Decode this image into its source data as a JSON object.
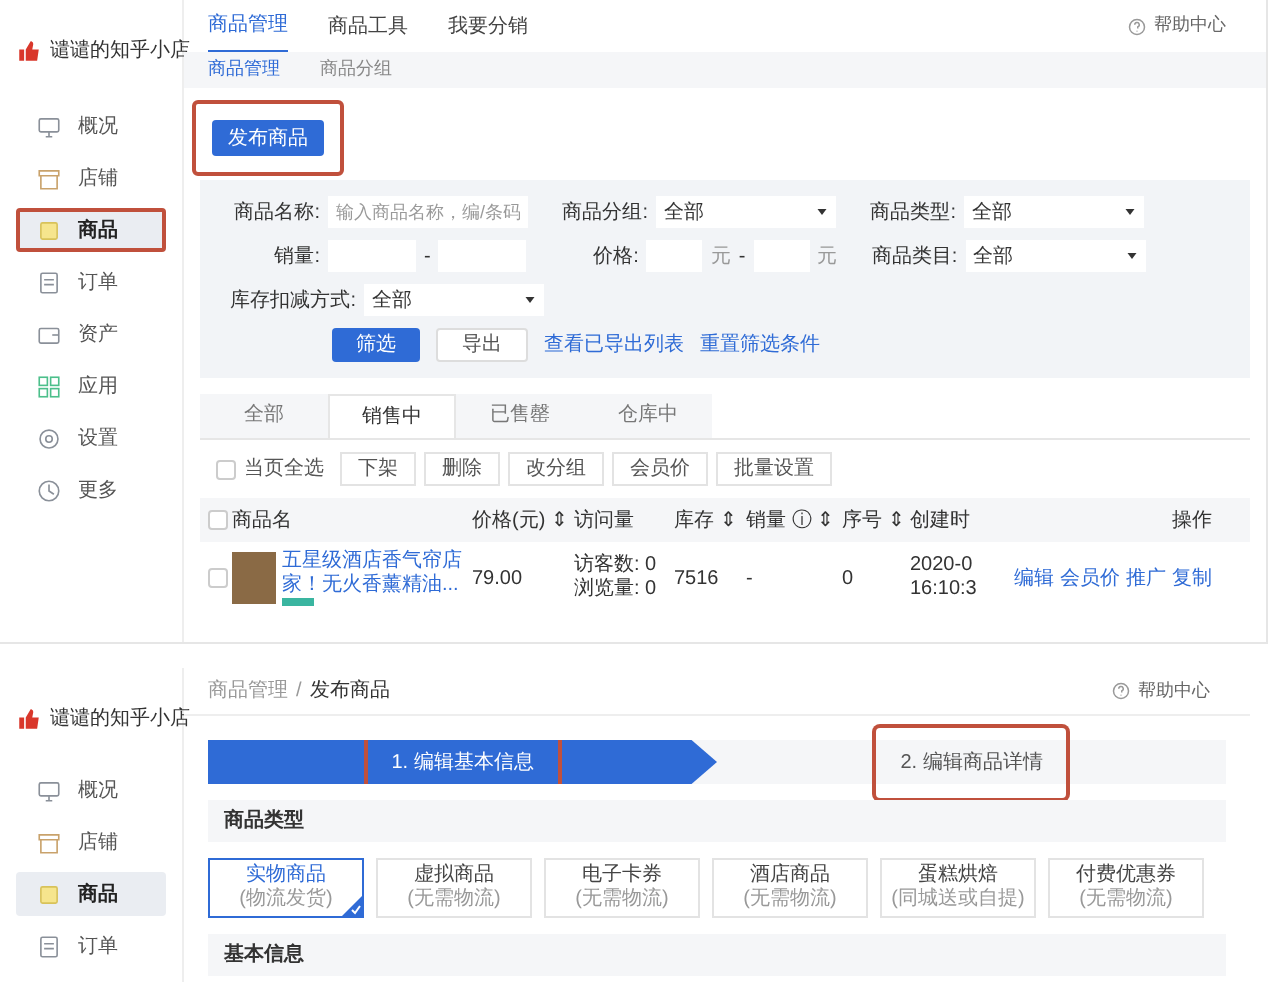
{
  "top_screen": {
    "shop": {
      "name": "谴谴的知乎小店"
    },
    "sidebar": {
      "items": [
        {
          "label": "概况",
          "selected": false,
          "highlighted": false
        },
        {
          "label": "店铺",
          "selected": false,
          "highlighted": false
        },
        {
          "label": "商品",
          "selected": true,
          "highlighted": true
        },
        {
          "label": "订单",
          "selected": false,
          "highlighted": false
        },
        {
          "label": "资产",
          "selected": false,
          "highlighted": false
        },
        {
          "label": "应用",
          "selected": false,
          "highlighted": false
        },
        {
          "label": "设置",
          "selected": false,
          "highlighted": false
        },
        {
          "label": "更多",
          "selected": false,
          "highlighted": false
        }
      ]
    },
    "top_tabs": [
      {
        "label": "商品管理",
        "selected": true
      },
      {
        "label": "商品工具",
        "selected": false
      },
      {
        "label": "我要分销",
        "selected": false
      }
    ],
    "help": "帮助中心",
    "sub_tabs": [
      {
        "label": "商品管理",
        "selected": true
      },
      {
        "label": "商品分组",
        "selected": false
      }
    ],
    "publish_button": {
      "label": "发布商品",
      "highlighted": true
    },
    "filters": {
      "name_label": "商品名称:",
      "name_placeholder": "输入商品名称，编/条码",
      "group_label": "商品分组:",
      "group_value": "全部",
      "type_label": "商品类型:",
      "type_value": "全部",
      "sales_label": "销量:",
      "sales_dash": "-",
      "price_label": "价格:",
      "price_unit_1": "元",
      "price_dash": "-",
      "price_unit_2": "元",
      "category_label": "商品类目:",
      "category_value": "全部",
      "stock_label": "库存扣减方式:",
      "stock_value": "全部",
      "filter_button": "筛选",
      "export_button": "导出",
      "exported_link": "查看已导出列表",
      "reset_link": "重置筛选条件"
    },
    "status_tabs": [
      {
        "label": "全部",
        "selected": false
      },
      {
        "label": "销售中",
        "selected": true
      },
      {
        "label": "已售罄",
        "selected": false
      },
      {
        "label": "仓库中",
        "selected": false
      }
    ],
    "bulk": {
      "select_all": {
        "label": "当页全选",
        "checked": false
      },
      "actions": [
        "下架",
        "删除",
        "改分组",
        "会员价",
        "批量设置"
      ]
    },
    "table": {
      "header_checked": false,
      "columns": [
        "商品名",
        "价格(元) ⇕",
        "访问量",
        "库存 ⇕",
        "销量 ⓘ ⇕",
        "序号 ⇕",
        "创建时",
        "操作"
      ],
      "rows": [
        {
          "checked": false,
          "name_line_1": "五星级酒店香气帘店",
          "name_line_2": "家！无火香薰精油...",
          "price": "79.00",
          "visits": "访客数: 0",
          "views": "浏览量: 0",
          "stock": "7516",
          "sales": "-",
          "order": "0",
          "created_1": "2020-0",
          "created_2": "16:10:3",
          "actions": [
            "编辑",
            "会员价",
            "推广",
            "复制"
          ]
        }
      ]
    }
  },
  "bottom_screen": {
    "shop": {
      "name": "谴谴的知乎小店"
    },
    "sidebar": {
      "items": [
        {
          "label": "概况",
          "selected": false
        },
        {
          "label": "店铺",
          "selected": false
        },
        {
          "label": "商品",
          "selected": true
        },
        {
          "label": "订单",
          "selected": false
        }
      ]
    },
    "breadcrumb": [
      "商品管理",
      "/",
      "发布商品"
    ],
    "help": "帮助中心",
    "steps": [
      {
        "label": "1. 编辑基本信息",
        "selected": true,
        "highlighted": true
      },
      {
        "label": "2. 编辑商品详情",
        "selected": false,
        "highlighted": true
      }
    ],
    "type_section": "商品类型",
    "types": [
      {
        "name": "实物商品",
        "note": "(物流发货)",
        "selected": true
      },
      {
        "name": "虚拟商品",
        "note": "(无需物流)",
        "selected": false
      },
      {
        "name": "电子卡券",
        "note": "(无需物流)",
        "selected": false
      },
      {
        "name": "酒店商品",
        "note": "(无需物流)",
        "selected": false
      },
      {
        "name": "蛋糕烘焙",
        "note": "(同城送或自提)",
        "selected": false
      },
      {
        "name": "付费优惠券",
        "note": "(无需物流)",
        "selected": false
      }
    ],
    "basic_section": "基本信息"
  }
}
